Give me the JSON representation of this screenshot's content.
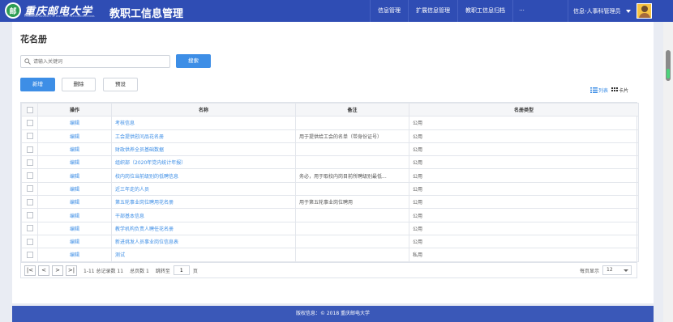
{
  "header": {
    "university_name": "重庆邮电大学",
    "university_subtitle": "CHONGQING UNIVERSITY OF POSTS AND TELECOMMUNICATIONS",
    "app_title": "教职工信息管理",
    "nav": [
      "信息管理",
      "扩展信息管理",
      "教职工信息归档"
    ],
    "more": "···",
    "user_role": "信息-人事科管理员",
    "logo_glyph": "邮"
  },
  "page": {
    "title": "花名册",
    "search_placeholder": "请输入关键词",
    "search_button": "搜索",
    "add_button": "新增",
    "delete_button": "删除",
    "preset_button": "预设",
    "view_list": "列表",
    "view_card": "卡片"
  },
  "table": {
    "headers": [
      "操作",
      "名称",
      "备注",
      "名册类型"
    ],
    "rows": [
      {
        "op": "编辑",
        "name": "考核信息",
        "note": "",
        "type": "公用"
      },
      {
        "op": "编辑",
        "name": "工会提供慰问品花名册",
        "note": "用于提供给工会的名单（带身份证号）",
        "type": "公用"
      },
      {
        "op": "编辑",
        "name": "财政供养全员基础数据",
        "note": "",
        "type": "公用"
      },
      {
        "op": "编辑",
        "name": "组织部（2020年党内统计年报）",
        "note": "",
        "type": "公用"
      },
      {
        "op": "编辑",
        "name": "校内岗位当前级别的低聘信息",
        "note": "务必，用于取校内岗目前所聘级别最低...",
        "type": "公用"
      },
      {
        "op": "编辑",
        "name": "近三年走的人员",
        "note": "",
        "type": "公用"
      },
      {
        "op": "编辑",
        "name": "第五轮事业岗位聘用花名册",
        "note": "用于第五轮事业岗位聘用",
        "type": "公用"
      },
      {
        "op": "编辑",
        "name": "干部基本信息",
        "note": "",
        "type": "公用"
      },
      {
        "op": "编辑",
        "name": "教学机构负责人聘任花名册",
        "note": "",
        "type": "公用"
      },
      {
        "op": "编辑",
        "name": "新进挑发人员事业岗位信息表",
        "note": "",
        "type": "公用"
      },
      {
        "op": "编辑",
        "name": "测试",
        "note": "",
        "type": "私用"
      }
    ]
  },
  "pager": {
    "first": "|<",
    "prev": "<",
    "next": ">",
    "last": ">|",
    "range": "1-11 总记录数 11",
    "total_pages": "总页数 1",
    "jump_label": "跳转至",
    "jump_value": "1",
    "page_unit": "页",
    "per_page_label": "每页显示",
    "per_page_value": "12"
  },
  "footer": {
    "copyright": "版权信息：© 2018 重庆邮电大学"
  },
  "colors": {
    "header_bg": "#2f4db4",
    "accent": "#3d8ee6",
    "footer_bg": "#3a58b8"
  }
}
